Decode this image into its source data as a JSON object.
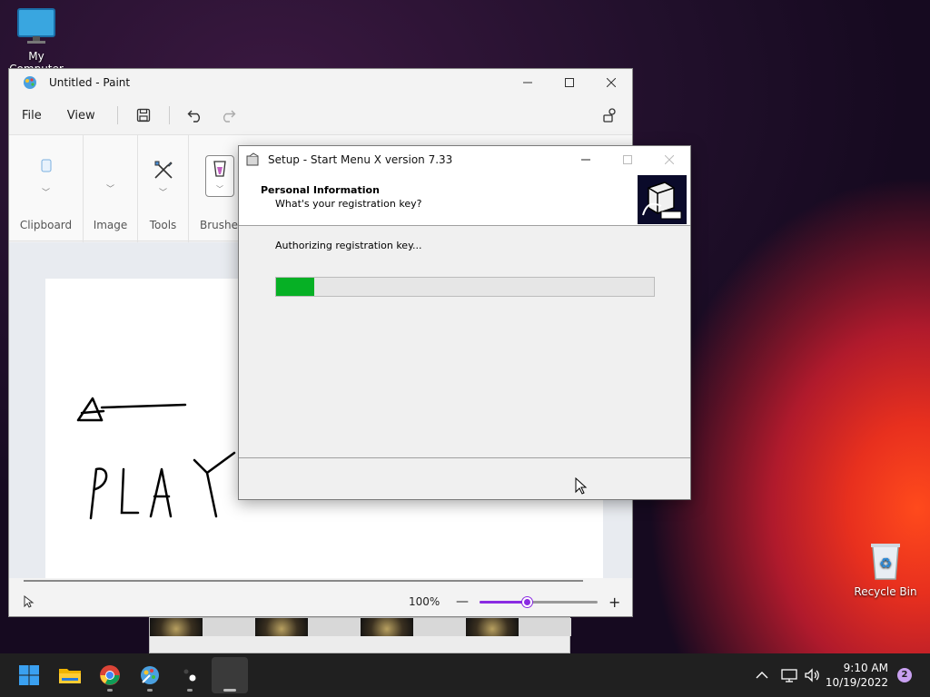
{
  "desktop": {
    "icons": [
      {
        "label": "My Computer"
      },
      {
        "label": "Recycle Bin"
      }
    ]
  },
  "paint": {
    "title": "Untitled - Paint",
    "menu": {
      "file": "File",
      "view": "View"
    },
    "ribbon": {
      "groups": [
        {
          "label": "Clipboard"
        },
        {
          "label": "Image"
        },
        {
          "label": "Tools"
        },
        {
          "label": "Brushes"
        }
      ]
    },
    "status": {
      "zoom": "100%",
      "zoom_minus": "—",
      "zoom_plus": "+",
      "zoom_fraction": 0.4
    }
  },
  "setup": {
    "title": "Setup - Start Menu X version 7.33",
    "header_title": "Personal Information",
    "header_subtitle": "What's your registration key?",
    "status_text": "Authorizing registration key...",
    "progress_fraction": 0.1
  },
  "taskbar": {
    "time": "9:10 AM",
    "date": "10/19/2022",
    "notification_count": "2"
  },
  "colors": {
    "progress_green": "#06b025",
    "zoom_accent": "#8a2be2"
  }
}
